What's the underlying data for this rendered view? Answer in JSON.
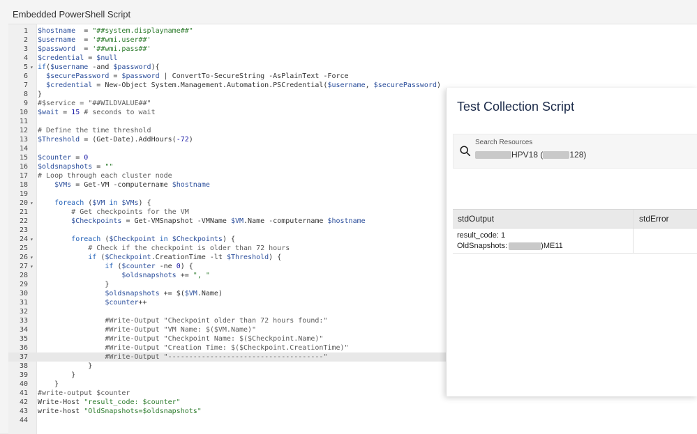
{
  "script_title": "Embedded PowerShell Script",
  "code_lines": [
    {
      "n": "1",
      "fold": false,
      "segs": [
        [
          "var",
          "$hostname"
        ],
        [
          "",
          "  = "
        ],
        [
          "str",
          "\"##system.displayname##\""
        ]
      ]
    },
    {
      "n": "2",
      "fold": false,
      "segs": [
        [
          "var",
          "$username"
        ],
        [
          "",
          "  = "
        ],
        [
          "str",
          "'##wmi.user##'"
        ]
      ]
    },
    {
      "n": "3",
      "fold": false,
      "segs": [
        [
          "var",
          "$password"
        ],
        [
          "",
          "  = "
        ],
        [
          "str",
          "'##wmi.pass##'"
        ]
      ]
    },
    {
      "n": "4",
      "fold": false,
      "segs": [
        [
          "var",
          "$credential"
        ],
        [
          "",
          " = "
        ],
        [
          "var",
          "$null"
        ]
      ]
    },
    {
      "n": "5",
      "fold": true,
      "segs": [
        [
          "kw",
          "if"
        ],
        [
          "",
          "("
        ],
        [
          "var",
          "$username"
        ],
        [
          "",
          " -and "
        ],
        [
          "var",
          "$password"
        ],
        [
          "",
          "){"
        ]
      ]
    },
    {
      "n": "6",
      "fold": false,
      "segs": [
        [
          "",
          "  "
        ],
        [
          "var",
          "$securePassword"
        ],
        [
          "",
          " = "
        ],
        [
          "var",
          "$password"
        ],
        [
          "",
          " | ConvertTo-SecureString -AsPlainText -Force"
        ]
      ]
    },
    {
      "n": "7",
      "fold": false,
      "segs": [
        [
          "",
          "  "
        ],
        [
          "var",
          "$credential"
        ],
        [
          "",
          " = New-Object System.Management.Automation.PSCredential("
        ],
        [
          "var",
          "$username"
        ],
        [
          "",
          ", "
        ],
        [
          "var",
          "$securePassword"
        ],
        [
          "",
          ")"
        ]
      ]
    },
    {
      "n": "8",
      "fold": false,
      "segs": [
        [
          "",
          "}"
        ]
      ]
    },
    {
      "n": "9",
      "fold": false,
      "segs": [
        [
          "cmt",
          "#$service = \"##WILDVALUE##\""
        ]
      ]
    },
    {
      "n": "10",
      "fold": false,
      "segs": [
        [
          "var",
          "$wait"
        ],
        [
          "",
          " = "
        ],
        [
          "num",
          "15"
        ],
        [
          "cmt",
          " # seconds to wait"
        ]
      ]
    },
    {
      "n": "11",
      "fold": false,
      "segs": []
    },
    {
      "n": "12",
      "fold": false,
      "segs": [
        [
          "cmt",
          "# Define the time threshold"
        ]
      ]
    },
    {
      "n": "13",
      "fold": false,
      "segs": [
        [
          "var",
          "$Threshold"
        ],
        [
          "",
          " = (Get-Date).AddHours("
        ],
        [
          "num",
          "-72"
        ],
        [
          "",
          ")"
        ]
      ]
    },
    {
      "n": "14",
      "fold": false,
      "segs": []
    },
    {
      "n": "15",
      "fold": false,
      "segs": [
        [
          "var",
          "$counter"
        ],
        [
          "",
          " = "
        ],
        [
          "num",
          "0"
        ]
      ]
    },
    {
      "n": "16",
      "fold": false,
      "segs": [
        [
          "var",
          "$oldsnapshots"
        ],
        [
          "",
          " = "
        ],
        [
          "str",
          "\"\""
        ]
      ]
    },
    {
      "n": "17",
      "fold": false,
      "segs": [
        [
          "cmt",
          "# Loop through each cluster node"
        ]
      ]
    },
    {
      "n": "18",
      "fold": false,
      "segs": [
        [
          "",
          "    "
        ],
        [
          "var",
          "$VMs"
        ],
        [
          "",
          " = Get-VM -computername "
        ],
        [
          "var",
          "$hostname"
        ]
      ]
    },
    {
      "n": "19",
      "fold": false,
      "segs": []
    },
    {
      "n": "20",
      "fold": true,
      "segs": [
        [
          "",
          "    "
        ],
        [
          "kw",
          "foreach"
        ],
        [
          "",
          " ("
        ],
        [
          "var",
          "$VM"
        ],
        [
          "kw",
          " in "
        ],
        [
          "var",
          "$VMs"
        ],
        [
          "",
          ") {"
        ]
      ]
    },
    {
      "n": "21",
      "fold": false,
      "segs": [
        [
          "",
          "        "
        ],
        [
          "cmt",
          "# Get checkpoints for the VM"
        ]
      ]
    },
    {
      "n": "22",
      "fold": false,
      "segs": [
        [
          "",
          "        "
        ],
        [
          "var",
          "$Checkpoints"
        ],
        [
          "",
          " = Get-VMSnapshot -VMName "
        ],
        [
          "var",
          "$VM"
        ],
        [
          "",
          ".Name -computername "
        ],
        [
          "var",
          "$hostname"
        ]
      ]
    },
    {
      "n": "23",
      "fold": false,
      "segs": []
    },
    {
      "n": "24",
      "fold": true,
      "segs": [
        [
          "",
          "        "
        ],
        [
          "kw",
          "foreach"
        ],
        [
          "",
          " ("
        ],
        [
          "var",
          "$Checkpoint"
        ],
        [
          "kw",
          " in "
        ],
        [
          "var",
          "$Checkpoints"
        ],
        [
          "",
          ") {"
        ]
      ]
    },
    {
      "n": "25",
      "fold": false,
      "segs": [
        [
          "",
          "            "
        ],
        [
          "cmt",
          "# Check if the checkpoint is older than 72 hours"
        ]
      ]
    },
    {
      "n": "26",
      "fold": true,
      "segs": [
        [
          "",
          "            "
        ],
        [
          "kw",
          "if"
        ],
        [
          "",
          " ("
        ],
        [
          "var",
          "$Checkpoint"
        ],
        [
          "",
          ".CreationTime -lt "
        ],
        [
          "var",
          "$Threshold"
        ],
        [
          "",
          ") {"
        ]
      ]
    },
    {
      "n": "27",
      "fold": true,
      "segs": [
        [
          "",
          "                "
        ],
        [
          "kw",
          "if"
        ],
        [
          "",
          " ("
        ],
        [
          "var",
          "$counter"
        ],
        [
          "",
          " -ne "
        ],
        [
          "num",
          "0"
        ],
        [
          "",
          ") {"
        ]
      ]
    },
    {
      "n": "28",
      "fold": false,
      "segs": [
        [
          "",
          "                    "
        ],
        [
          "var",
          "$oldsnapshots"
        ],
        [
          "",
          " += "
        ],
        [
          "str",
          "\", \""
        ]
      ]
    },
    {
      "n": "29",
      "fold": false,
      "segs": [
        [
          "",
          "                }"
        ]
      ]
    },
    {
      "n": "30",
      "fold": false,
      "segs": [
        [
          "",
          "                "
        ],
        [
          "var",
          "$oldsnapshots"
        ],
        [
          "",
          " += $("
        ],
        [
          "var",
          "$VM"
        ],
        [
          "",
          ".Name)"
        ]
      ]
    },
    {
      "n": "31",
      "fold": false,
      "segs": [
        [
          "",
          "                "
        ],
        [
          "var",
          "$counter"
        ],
        [
          "",
          "++"
        ]
      ]
    },
    {
      "n": "32",
      "fold": false,
      "segs": []
    },
    {
      "n": "33",
      "fold": false,
      "segs": [
        [
          "",
          "                "
        ],
        [
          "cmt",
          "#Write-Output \"Checkpoint older than 72 hours found:\""
        ]
      ]
    },
    {
      "n": "34",
      "fold": false,
      "segs": [
        [
          "",
          "                "
        ],
        [
          "cmt",
          "#Write-Output \"VM Name: $($VM.Name)\""
        ]
      ]
    },
    {
      "n": "35",
      "fold": false,
      "segs": [
        [
          "",
          "                "
        ],
        [
          "cmt",
          "#Write-Output \"Checkpoint Name: $($Checkpoint.Name)\""
        ]
      ]
    },
    {
      "n": "36",
      "fold": false,
      "segs": [
        [
          "",
          "                "
        ],
        [
          "cmt",
          "#Write-Output \"Creation Time: $($Checkpoint.CreationTime)\""
        ]
      ]
    },
    {
      "n": "37",
      "fold": false,
      "active": true,
      "segs": [
        [
          "",
          "                "
        ],
        [
          "cmt",
          "#Write-Output \"-------------------------------------\""
        ]
      ]
    },
    {
      "n": "38",
      "fold": false,
      "segs": [
        [
          "",
          "            }"
        ]
      ]
    },
    {
      "n": "39",
      "fold": false,
      "segs": [
        [
          "",
          "        }"
        ]
      ]
    },
    {
      "n": "40",
      "fold": false,
      "segs": [
        [
          "",
          "    }"
        ]
      ]
    },
    {
      "n": "41",
      "fold": false,
      "segs": [
        [
          "cmt",
          "#write-output $counter"
        ]
      ]
    },
    {
      "n": "42",
      "fold": false,
      "segs": [
        [
          "",
          "Write-Host "
        ],
        [
          "str",
          "\"result_code: $counter\""
        ]
      ]
    },
    {
      "n": "43",
      "fold": false,
      "segs": [
        [
          "",
          "write-host "
        ],
        [
          "str",
          "\"OldSnapshots=$oldsnapshots\""
        ]
      ]
    },
    {
      "n": "44",
      "fold": false,
      "segs": []
    }
  ],
  "modal": {
    "title": "Test Collection Script",
    "search": {
      "label": "Search Resources",
      "value_mid": "HPV18 (",
      "value_end": "128)"
    },
    "table": {
      "headers": [
        "stdOutput",
        "stdError"
      ],
      "row": {
        "line1": "result_code: 1",
        "line2_prefix": "OldSnapshots:",
        "line2_suffix": ")ME11"
      }
    }
  },
  "icons": {
    "search": "search-icon",
    "fold": "chevron-down-icon"
  }
}
